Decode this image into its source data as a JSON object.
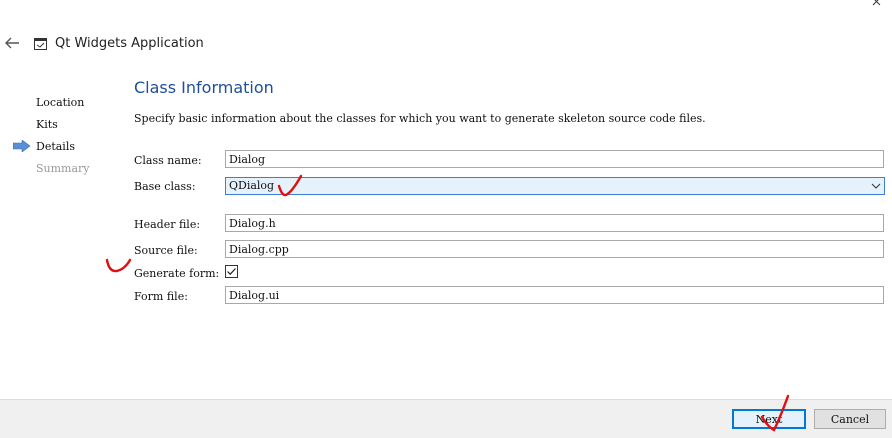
{
  "window": {
    "title": "Qt Widgets Application"
  },
  "sidebar": {
    "steps": [
      {
        "label": "Location"
      },
      {
        "label": "Kits"
      },
      {
        "label": "Details"
      },
      {
        "label": "Summary"
      }
    ]
  },
  "page": {
    "title": "Class Information",
    "description": "Specify basic information about the classes for which you want to generate skeleton source code files."
  },
  "form": {
    "class_name": {
      "label": "Class name:",
      "value": "Dialog"
    },
    "base_class": {
      "label": "Base class:",
      "value": "QDialog"
    },
    "header_file": {
      "label": "Header file:",
      "value": "Dialog.h"
    },
    "source_file": {
      "label": "Source file:",
      "value": "Dialog.cpp"
    },
    "generate_form": {
      "label": "Generate form:",
      "checked": true
    },
    "form_file": {
      "label": "Form file:",
      "value": "Dialog.ui"
    }
  },
  "buttons": {
    "next": "Next",
    "cancel": "Cancel"
  },
  "colors": {
    "accent": "#0078d7",
    "title_blue": "#1f4e9a",
    "annotation_red": "#e01010",
    "current_step_arrow": "#5a8fd6"
  }
}
